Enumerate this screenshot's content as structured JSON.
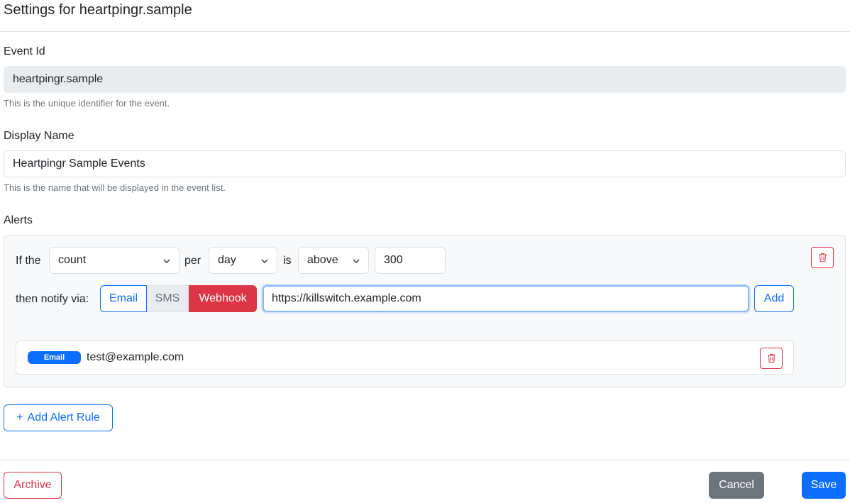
{
  "header": {
    "title": "Settings for heartpingr.sample"
  },
  "event_id": {
    "label": "Event Id",
    "value": "heartpingr.sample",
    "help": "This is the unique identifier for the event."
  },
  "display_name": {
    "label": "Display Name",
    "value": "Heartpingr Sample Events",
    "help": "This is the name that will be displayed in the event list."
  },
  "alerts": {
    "label": "Alerts",
    "rule": {
      "if_label": "If the",
      "metric": "count",
      "per_label": "per",
      "period": "day",
      "is_label": "is",
      "comparison": "above",
      "threshold": "300",
      "notify_label": "then notify via:",
      "channels": {
        "email": "Email",
        "sms": "SMS",
        "webhook": "Webhook"
      },
      "selected_channel": "Webhook",
      "target_value": "https://killswitch.example.com",
      "add_label": "Add",
      "recipients": [
        {
          "type": "Email",
          "value": "test@example.com"
        }
      ]
    },
    "add_rule_label": "Add Alert Rule",
    "add_rule_icon": "+"
  },
  "footer": {
    "archive": "Archive",
    "cancel": "Cancel",
    "save": "Save"
  },
  "colors": {
    "primary": "#0d6efd",
    "danger": "#dc3545",
    "secondary": "#6c757d"
  }
}
